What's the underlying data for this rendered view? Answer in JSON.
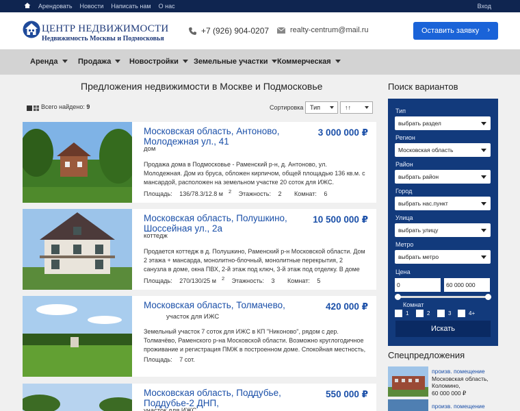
{
  "topbar": {
    "nav": [
      "Арендовать",
      "Новости",
      "Написать нам",
      "О нас"
    ],
    "login": "Вход"
  },
  "header": {
    "logo_title": "ЦЕНТР НЕДВИЖИМОСТИ",
    "logo_subtitle": "Недвижимость Москвы и Подмосковья",
    "phone": "+7 (926) 904-0207",
    "email": "realty-centrum@mail.ru",
    "order_button": "Оставить заявку",
    "order_arrow": "›"
  },
  "menu": [
    "Аренда",
    "Продажа",
    "Новостройки",
    "Земельные участки",
    "Коммерческая"
  ],
  "main": {
    "title": "Предложения недвижимости в Москве и Подмосковье",
    "found_label": "Всего найдено:",
    "found_count": "9",
    "sort_label": "Сортировка",
    "sort_field": "Тип",
    "sort_order": "↑↑"
  },
  "listings": [
    {
      "title": "Московская область, Антоново, Молодежная ул., 41",
      "price": "3 000 000 ₽",
      "type": "дом",
      "description": "Продажа дома в Подмосковье - Раменский р-н, д. Антоново, ул. Молодежная. Дом из бруса, обложен кирпичом, общей площадью 136 кв.м. с мансардой, расположен на земельном участке 20 соток для ИЖС. Фундамент дома из...",
      "area_label": "Площадь:",
      "area": "136/78.3/12.8 м",
      "area_sup": "2",
      "floors_label": "Этажность:",
      "floors": "2",
      "rooms_label": "Комнат:",
      "rooms": "6"
    },
    {
      "title": "Московская область, Полушкино, Шоссейная ул., 2а",
      "price": "10 500 000 ₽",
      "type": "коттедж",
      "description": "Продается коттедж в д. Полушкино, Раменский р-н Московской области. Дом 2 этажа + мансарда, монолитно-блочный, монолитные перекрытия, 2 санузла в доме, окна ПВХ, 2-й этаж под ключ, 3-й этаж под отделку. В доме есть горячая и...",
      "area_label": "Площадь:",
      "area": "270/130/25 м",
      "area_sup": "2",
      "floors_label": "Этажность:",
      "floors": "3",
      "rooms_label": "Комнат:",
      "rooms": "5"
    },
    {
      "title": "Московская область, Толмачево,",
      "price": "420 000 ₽",
      "type": "участок для ИЖС",
      "description": "Земельный участок 7 соток для ИЖС в КП \"Никоново\", рядом с дер. Толмачёво, Раменского р-на Московской области. Возможно круглогодичное проживание и регистрация ПМЖ в построенном доме. Спокойная местность, рядом грибной...",
      "area_label": "Площадь:",
      "area": "7 сот."
    },
    {
      "title": "Московская область, Поддубье, Поддубье-2 ДНП,",
      "price": "550 000 ₽",
      "type": "участок для ИЖС"
    }
  ],
  "search": {
    "title": "Поиск вариантов",
    "type_label": "Тип",
    "type_value": "выбрать раздел",
    "region_label": "Регион",
    "region_value": "Московская область",
    "district_label": "Район",
    "district_value": "выбрать район",
    "city_label": "Город",
    "city_value": "выбрать нас.пункт",
    "street_label": "Улица",
    "street_value": "выбрать улицу",
    "metro_label": "Метро",
    "metro_value": "выбрать метро",
    "price_label": "Цена",
    "price_min": "0",
    "price_max": "60 000 000",
    "price_min_fraction": 0,
    "price_max_fraction": 1,
    "rooms_label": "Комнат",
    "rooms_options": [
      "1",
      "2",
      "3",
      "4+"
    ],
    "submit": "Искать"
  },
  "special": {
    "title": "Спецпредложения",
    "items": [
      {
        "type": "произв. помещение",
        "location": "Московская область, Коломино,",
        "price": "60 000 000 ₽"
      },
      {
        "type": "произв. помещение"
      }
    ]
  }
}
